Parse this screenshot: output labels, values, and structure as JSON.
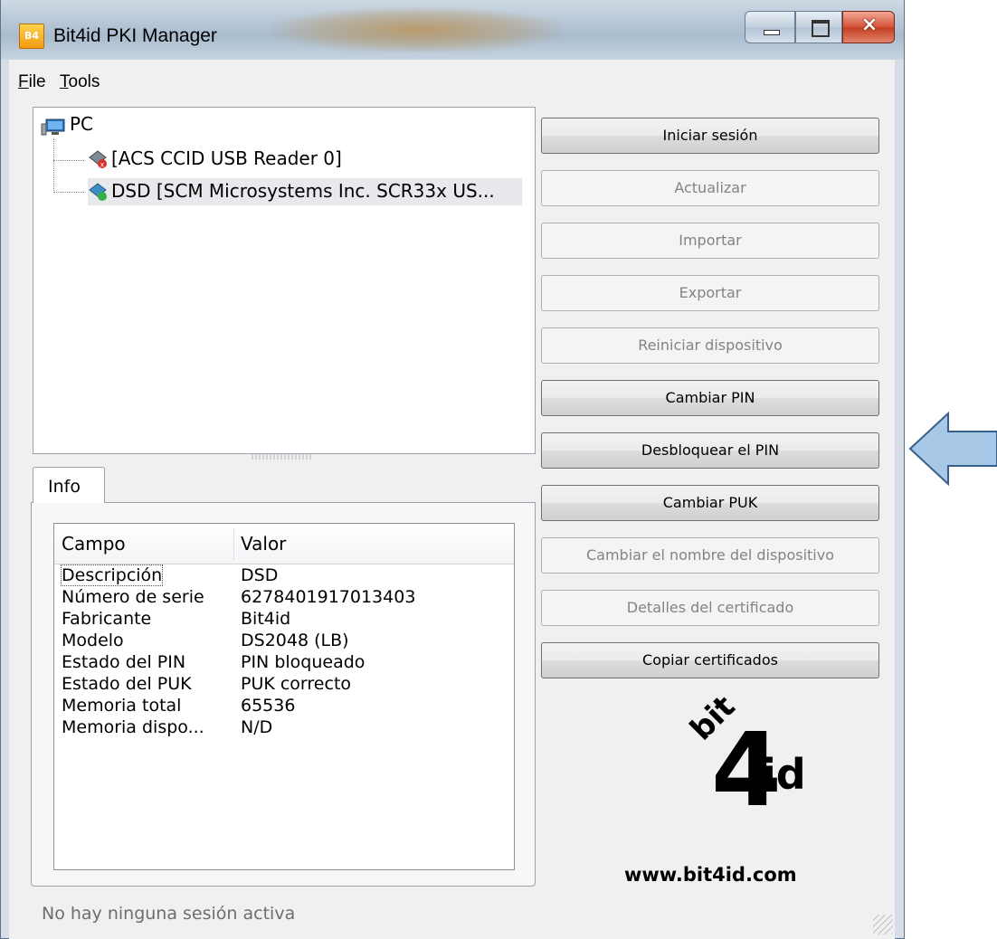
{
  "window": {
    "title": "Bit4id PKI Manager",
    "icon_label": "B4"
  },
  "menu": {
    "file": {
      "accel": "F",
      "rest": "ile"
    },
    "tools": {
      "accel": "T",
      "rest": "ools"
    }
  },
  "tree": {
    "root": "PC",
    "items": [
      {
        "label": "[ACS CCID USB Reader 0]",
        "status": "error"
      },
      {
        "label": "DSD [SCM Microsystems Inc. SCR33x US...",
        "status": "ok"
      }
    ]
  },
  "info_tab": {
    "label": "Info"
  },
  "table": {
    "headers": [
      "Campo",
      "Valor"
    ],
    "rows": [
      [
        "Descripción",
        "DSD"
      ],
      [
        "Número de serie",
        "6278401917013403"
      ],
      [
        "Fabricante",
        "Bit4id"
      ],
      [
        "Modelo",
        "DS2048 (LB)"
      ],
      [
        "Estado del PIN",
        "PIN bloqueado"
      ],
      [
        "Estado del PUK",
        "PUK correcto"
      ],
      [
        "Memoria total",
        "65536"
      ],
      [
        "Memoria dispo...",
        "N/D"
      ]
    ]
  },
  "buttons": [
    {
      "label": "Iniciar sesión",
      "enabled": true
    },
    {
      "label": "Actualizar",
      "enabled": false
    },
    {
      "label": "Importar",
      "enabled": false
    },
    {
      "label": "Exportar",
      "enabled": false
    },
    {
      "label": "Reiniciar dispositivo",
      "enabled": false
    },
    {
      "label": "Cambiar PIN",
      "enabled": true
    },
    {
      "label": "Desbloquear el PIN",
      "enabled": true
    },
    {
      "label": "Cambiar PUK",
      "enabled": true
    },
    {
      "label": "Cambiar el nombre del dispositivo",
      "enabled": false
    },
    {
      "label": "Detalles del certificado",
      "enabled": false
    },
    {
      "label": "Copiar certificados",
      "enabled": true
    }
  ],
  "logo": {
    "top": "bit",
    "digit": "4",
    "suffix": "id"
  },
  "website": "www.bit4id.com",
  "status_bar": "No hay ninguna sesión activa",
  "colors": {
    "arrow_fill": "#a8c8e8",
    "arrow_stroke": "#3a5f8a"
  }
}
